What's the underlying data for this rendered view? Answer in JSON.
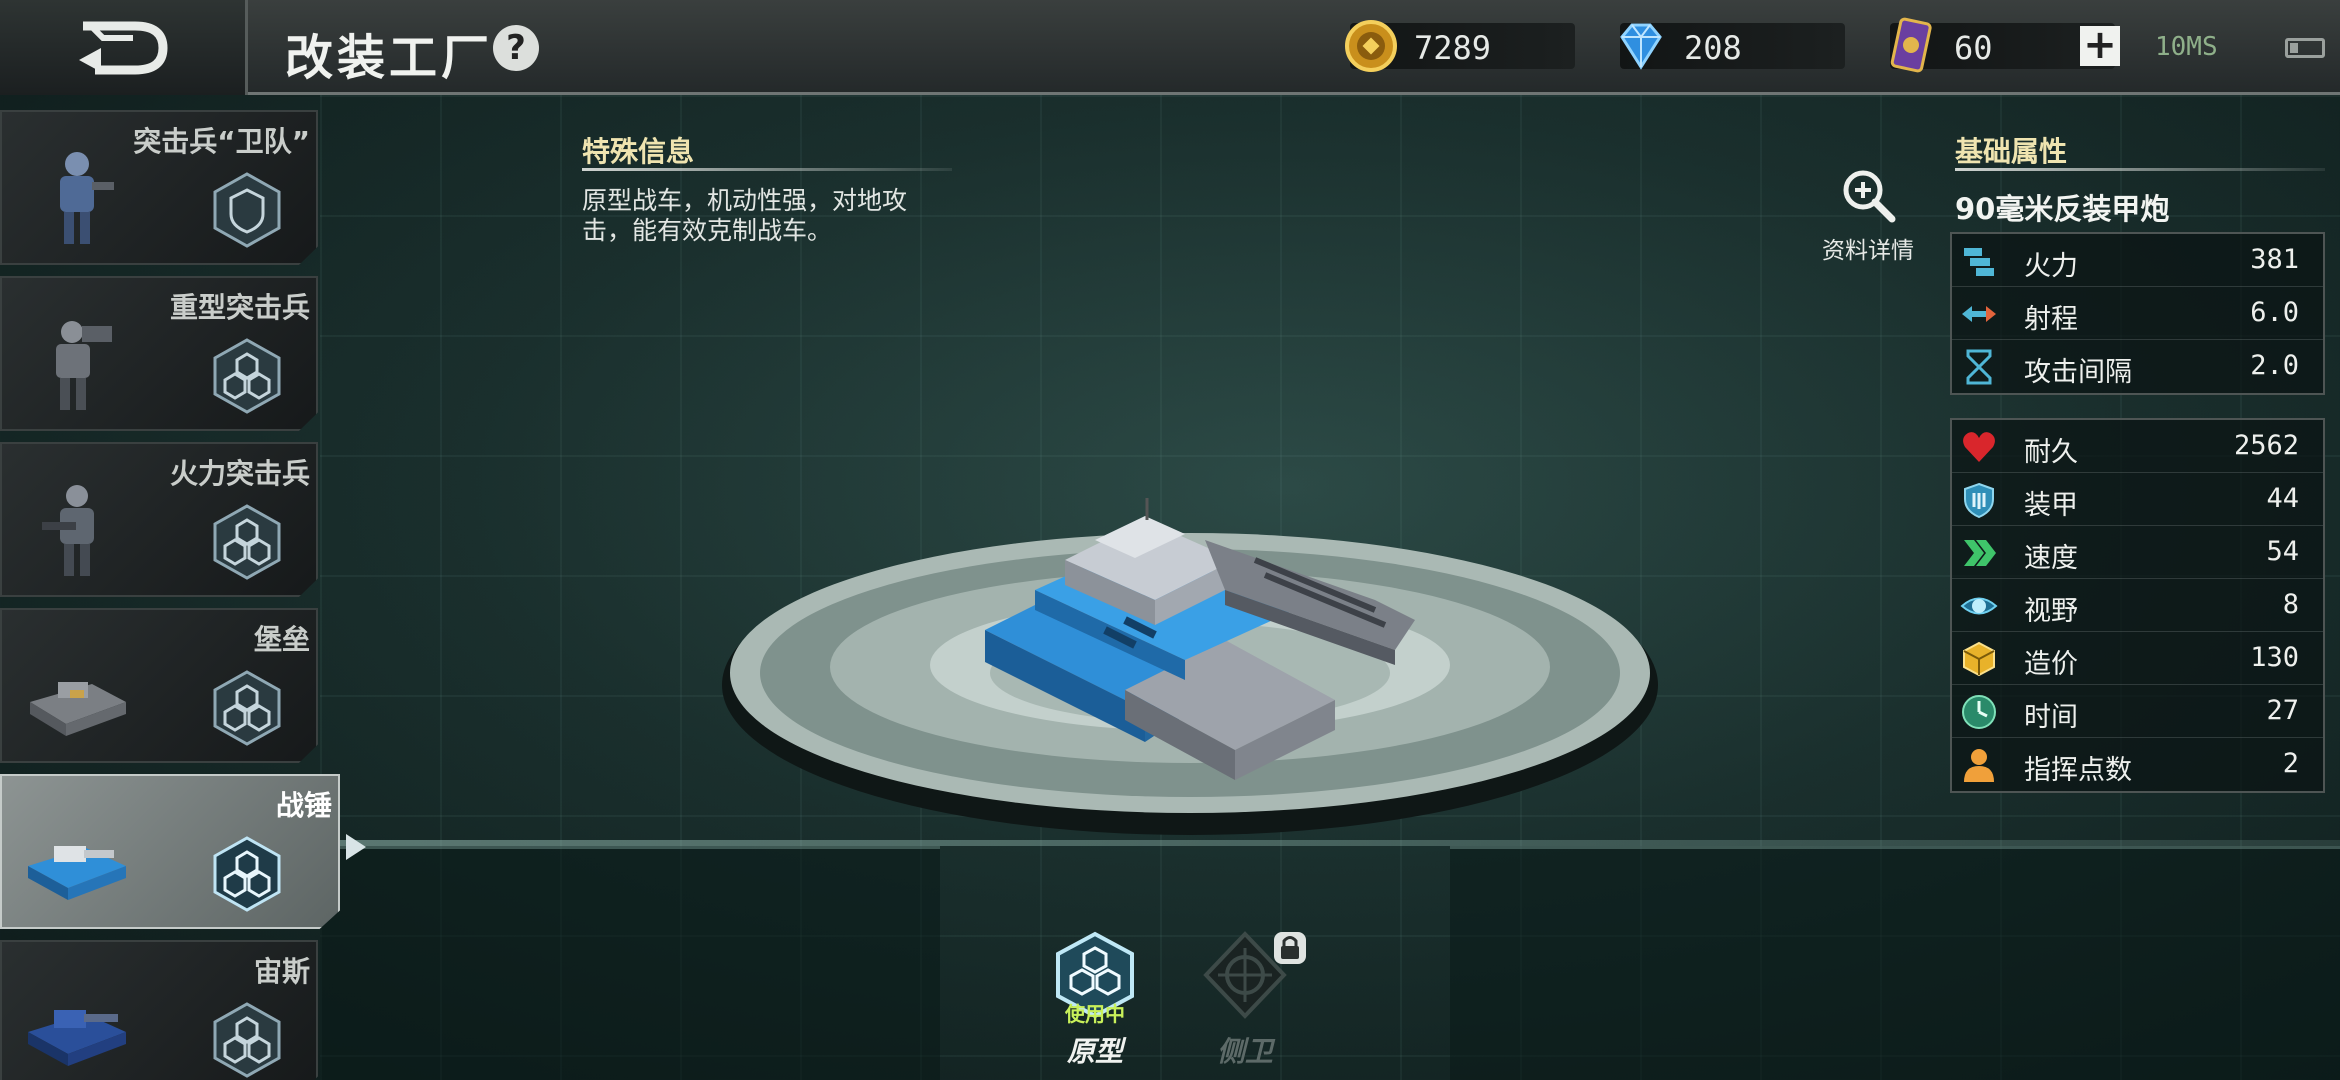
{
  "header": {
    "title": "改装工厂",
    "help": "?",
    "gold": "7289",
    "diamonds": "208",
    "cards": "60",
    "plus": "+",
    "network": "10MS"
  },
  "sidebar": {
    "items": [
      {
        "name": "突击兵“卫队”"
      },
      {
        "name": "重型突击兵"
      },
      {
        "name": "火力突击兵"
      },
      {
        "name": "堡垒"
      },
      {
        "name": "战锤"
      },
      {
        "name": "宙斯"
      }
    ]
  },
  "special_info": {
    "title": "特殊信息",
    "description": "原型战车，机动性强，对地攻击，能有效克制战车。"
  },
  "detail_button": {
    "label": "资料详情"
  },
  "base_attributes": {
    "title": "基础属性",
    "weapon": "90毫米反装甲炮",
    "attack_stats": [
      {
        "label": "火力",
        "value": "381",
        "icon": "firepower-icon"
      },
      {
        "label": "射程",
        "value": "6.0",
        "icon": "range-icon"
      },
      {
        "label": "攻击间隔",
        "value": "2.0",
        "icon": "hourglass-icon"
      }
    ],
    "unit_stats": [
      {
        "label": "耐久",
        "value": "2562",
        "icon": "heart-icon"
      },
      {
        "label": "装甲",
        "value": "44",
        "icon": "shield-icon"
      },
      {
        "label": "速度",
        "value": "54",
        "icon": "chevrons-icon"
      },
      {
        "label": "视野",
        "value": "8",
        "icon": "eye-icon"
      },
      {
        "label": "造价",
        "value": "130",
        "icon": "cube-icon"
      },
      {
        "label": "时间",
        "value": "27",
        "icon": "clock-icon"
      },
      {
        "label": "指挥点数",
        "value": "2",
        "icon": "commander-icon"
      }
    ]
  },
  "variants": [
    {
      "name": "原型",
      "status": "使用中"
    },
    {
      "name": "侧卫",
      "status": ""
    }
  ],
  "colors": {
    "accent_blue": "#2f9ad8",
    "title_gold": "#efe4b0",
    "in_use_green": "#c8f05a"
  }
}
